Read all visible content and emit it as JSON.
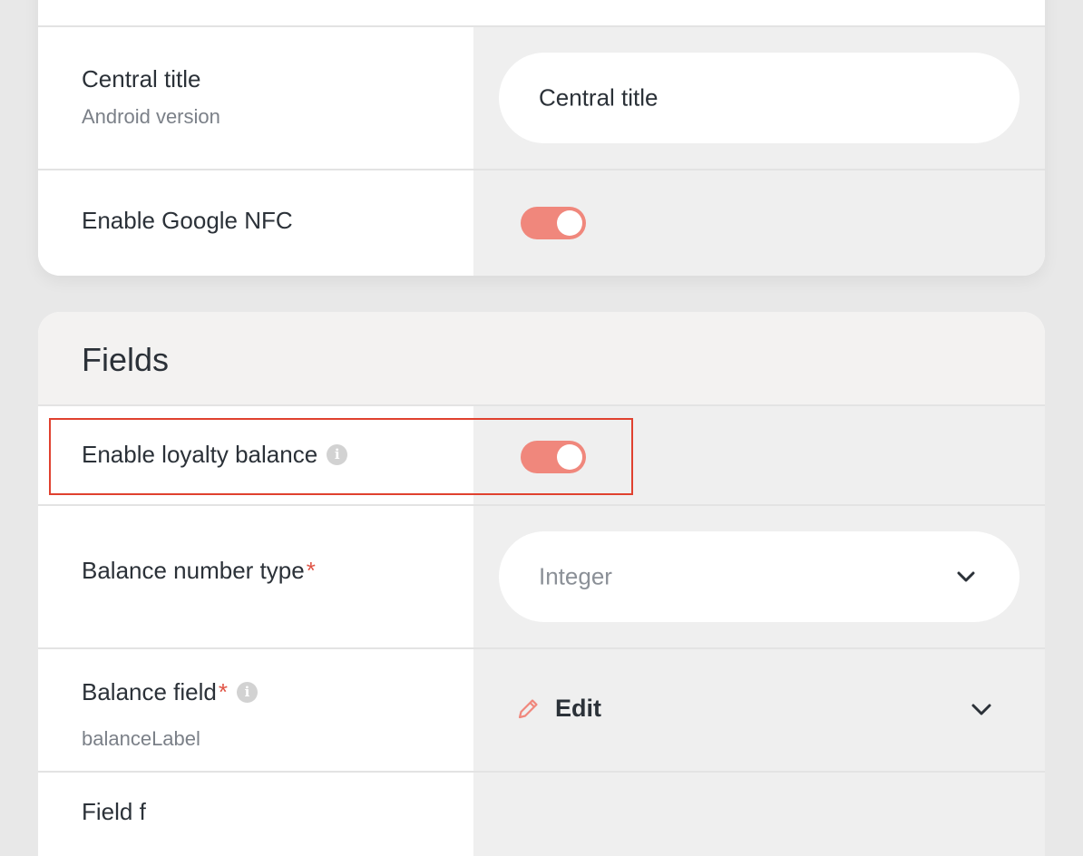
{
  "top_card": {
    "central_title": {
      "label": "Central title",
      "sublabel": "Android version",
      "value": "Central title"
    },
    "google_nfc": {
      "label": "Enable Google NFC",
      "enabled": true
    }
  },
  "fields": {
    "title": "Fields",
    "loyalty_balance": {
      "label": "Enable loyalty balance",
      "enabled": true
    },
    "balance_number_type": {
      "label": "Balance number type",
      "required_mark": "*",
      "placeholder": "Integer"
    },
    "balance_field": {
      "label": "Balance field",
      "required_mark": "*",
      "sublabel": "balanceLabel",
      "edit_label": "Edit"
    },
    "next_row": {
      "label": "Field f"
    }
  },
  "colors": {
    "accent": "#f0877c",
    "required": "#e05446",
    "highlight_border": "#e0412f"
  },
  "icons": [
    "info-icon",
    "pencil-icon",
    "chevron-down-icon"
  ]
}
